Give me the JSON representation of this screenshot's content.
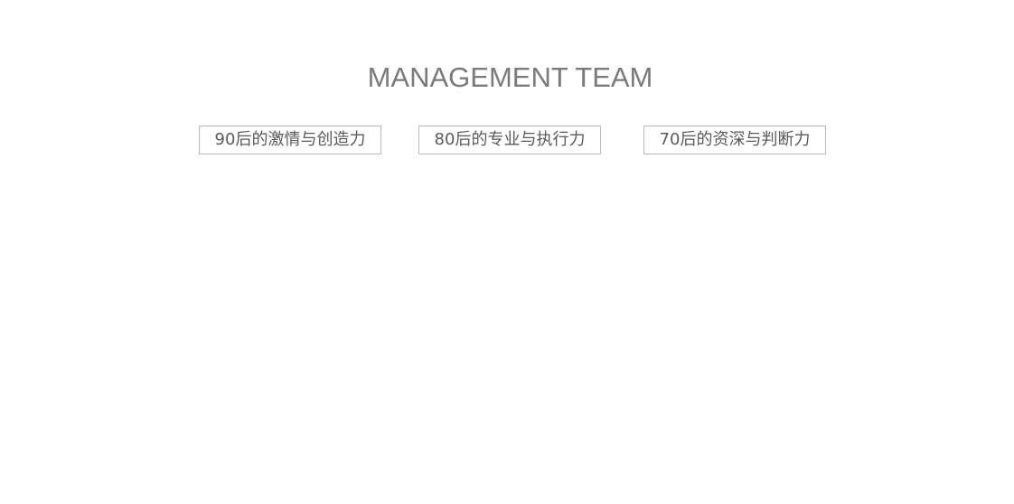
{
  "section": {
    "title": "MANAGEMENT TEAM"
  },
  "tags": [
    {
      "label": "90后的激情与创造力"
    },
    {
      "label": "80后的专业与执行力"
    },
    {
      "label": "70后的资深与判断力"
    }
  ],
  "colors": {
    "background": "#ffffff",
    "title": "#7a7a7a",
    "tag_text": "#5a5a5a",
    "tag_border": "#b8b8b8"
  }
}
